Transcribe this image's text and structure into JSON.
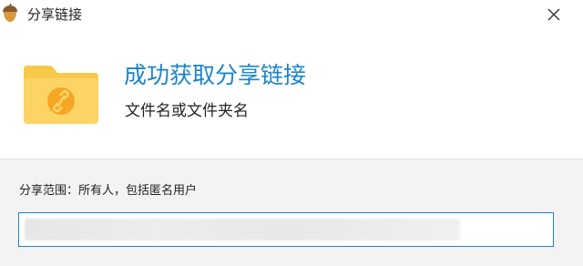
{
  "window": {
    "title": "分享链接",
    "app_icon": "acorn-icon",
    "close_icon": "close-icon"
  },
  "content": {
    "headline": "成功获取分享链接",
    "filename": "文件名或文件夹名",
    "folder_icon": "folder-link-icon"
  },
  "share": {
    "scope_label": "分享范围：所有人，包括匿名用户",
    "link_value": ""
  },
  "colors": {
    "accent": "#1b84c9",
    "folder_yellow": "#fcd465",
    "folder_badge": "#f5a623"
  }
}
